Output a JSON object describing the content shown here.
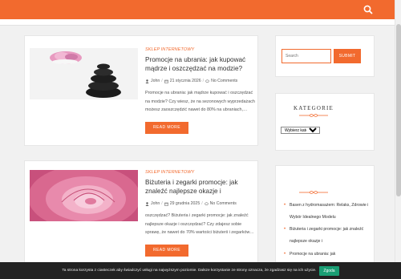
{
  "header": {
    "search_icon": "search-icon"
  },
  "posts": [
    {
      "category": "SKLEP INTERNETOWY",
      "title": "Promocje na ubrania: jak kupować mądrze i oszczędzać na modzie?",
      "author": "John",
      "date": "21 stycznia 2026",
      "comments": "No Comments",
      "excerpt": "Promocje na ubrania: jak mądrze kupować i oszczędzać na modzie? Czy wiesz, że na sezonowych wyprzedażach możesz zaoszczędzić nawet do 80% na ubraniach,…",
      "button": "READ MORE"
    },
    {
      "category": "SKLEP INTERNETOWY",
      "title": "Biżuteria i zegarki promocje: jak znaleźć najlepsze okazje i",
      "author": "John",
      "date": "29 grudnia 2025",
      "comments": "No Comments",
      "excerpt": "oszczędzać? Biżuteria i zegarki promocje: jak znaleźć najlepsze okazje i oszczędzać? Czy zdajesz sobie sprawę, że nawet do 70% wartości biżuterii i zegarków…",
      "button": "READ MORE"
    }
  ],
  "sidebar": {
    "search": {
      "placeholder": "Search",
      "button": "SUBMIT"
    },
    "categories": {
      "title": "KATEGORIE",
      "select": "Wybierz kategorię"
    },
    "recent": [
      "Basen z hydromasażem: Relaks, Zdrowie i Wybór Idealnego Modelu",
      "Biżuteria i zegarki promocje: jak znaleźć najlepsze okazje i",
      "Promocje na ubrania: jak"
    ]
  },
  "cookie": {
    "text": "Ta strona korzysta z ciasteczek aby świadczyć usługi na najwyższym poziomie. Dalsze korzystanie ze strony oznacza, że zgadzasz się na ich użycie.",
    "button": "Zgoda"
  },
  "colors": {
    "accent": "#f26a2e",
    "cookie_bg": "#222222",
    "cookie_button": "#1a9e74"
  }
}
